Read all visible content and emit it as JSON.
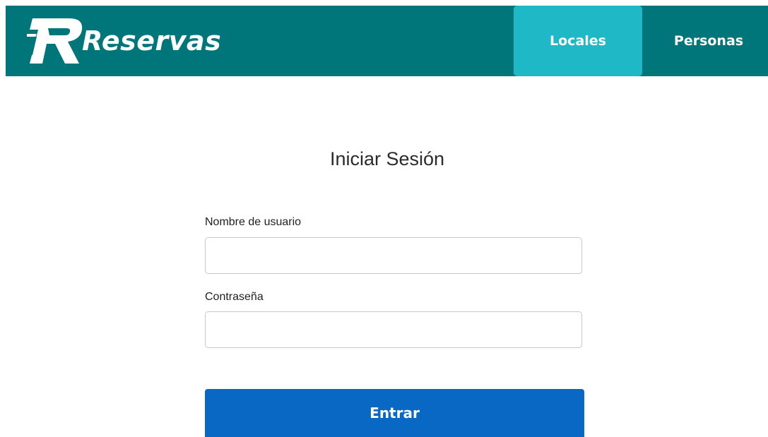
{
  "brand": {
    "logo_text": "Reservas",
    "logo_icon": "r-logo-icon",
    "color": "#00767a"
  },
  "nav": {
    "items": [
      {
        "label": "Locales",
        "active": true
      },
      {
        "label": "Personas",
        "active": false
      }
    ],
    "active_color": "#1fb8c6"
  },
  "login": {
    "title": "Iniciar Sesión",
    "username_label": "Nombre de usuario",
    "username_value": "",
    "password_label": "Contraseña",
    "password_value": "",
    "submit_label": "Entrar",
    "submit_color": "#0868c4"
  }
}
